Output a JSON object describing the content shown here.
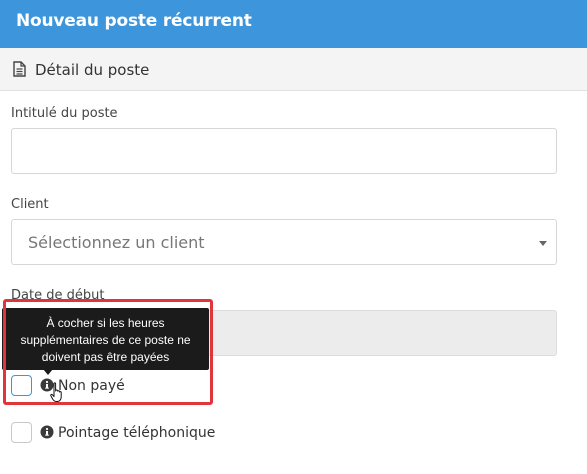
{
  "header": {
    "title": "Nouveau poste récurrent"
  },
  "section": {
    "title": "Détail du poste",
    "icon": "document-icon"
  },
  "form": {
    "job_title_label": "Intitulé du poste",
    "job_title_value": "",
    "client_label": "Client",
    "client_placeholder": "Sélectionnez un client",
    "start_date_label": "Date de début",
    "start_date_value": ""
  },
  "checkboxes": [
    {
      "label": "Non payé",
      "checked": false,
      "icon": "info-icon"
    },
    {
      "label": "Pointage téléphonique",
      "checked": false,
      "icon": "info-icon"
    }
  ],
  "tooltip": {
    "text_line1": "À cocher si les heures",
    "text_line2": "supplémentaires de ce poste ne",
    "text_line3": "doivent pas être payées"
  },
  "colors": {
    "header_bg": "#3d96db",
    "highlight": "#e0363b",
    "tooltip_bg": "#1b1b1b"
  }
}
